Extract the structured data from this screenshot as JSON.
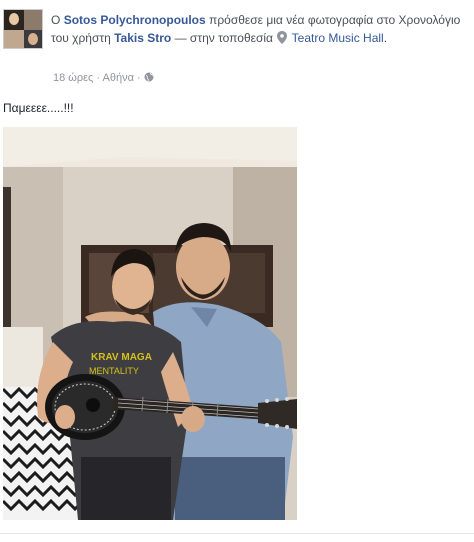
{
  "post": {
    "headline": {
      "prefix": "Ο",
      "author": "Sotos Polychronopoulos",
      "action": "πρόσθεσε μια νέα φωτογραφία στο Χρονολόγιο του χρήστη",
      "target": "Takis Stro",
      "location_prefix": "— στην τοποθεσία",
      "location": "Teatro Music Hall",
      "suffix": "."
    },
    "meta": {
      "time": "18 ώρες",
      "separator": "·",
      "place": "Αθήνα",
      "privacy_icon": "globe-icon"
    },
    "text": "Παμεεεε.....!!!",
    "photo": {
      "shirt_text_line1": "KRAV MAGA",
      "shirt_text_line2": "MENTALITY"
    }
  },
  "colors": {
    "link": "#365899",
    "meta": "#90949c",
    "text": "#1d2129"
  }
}
